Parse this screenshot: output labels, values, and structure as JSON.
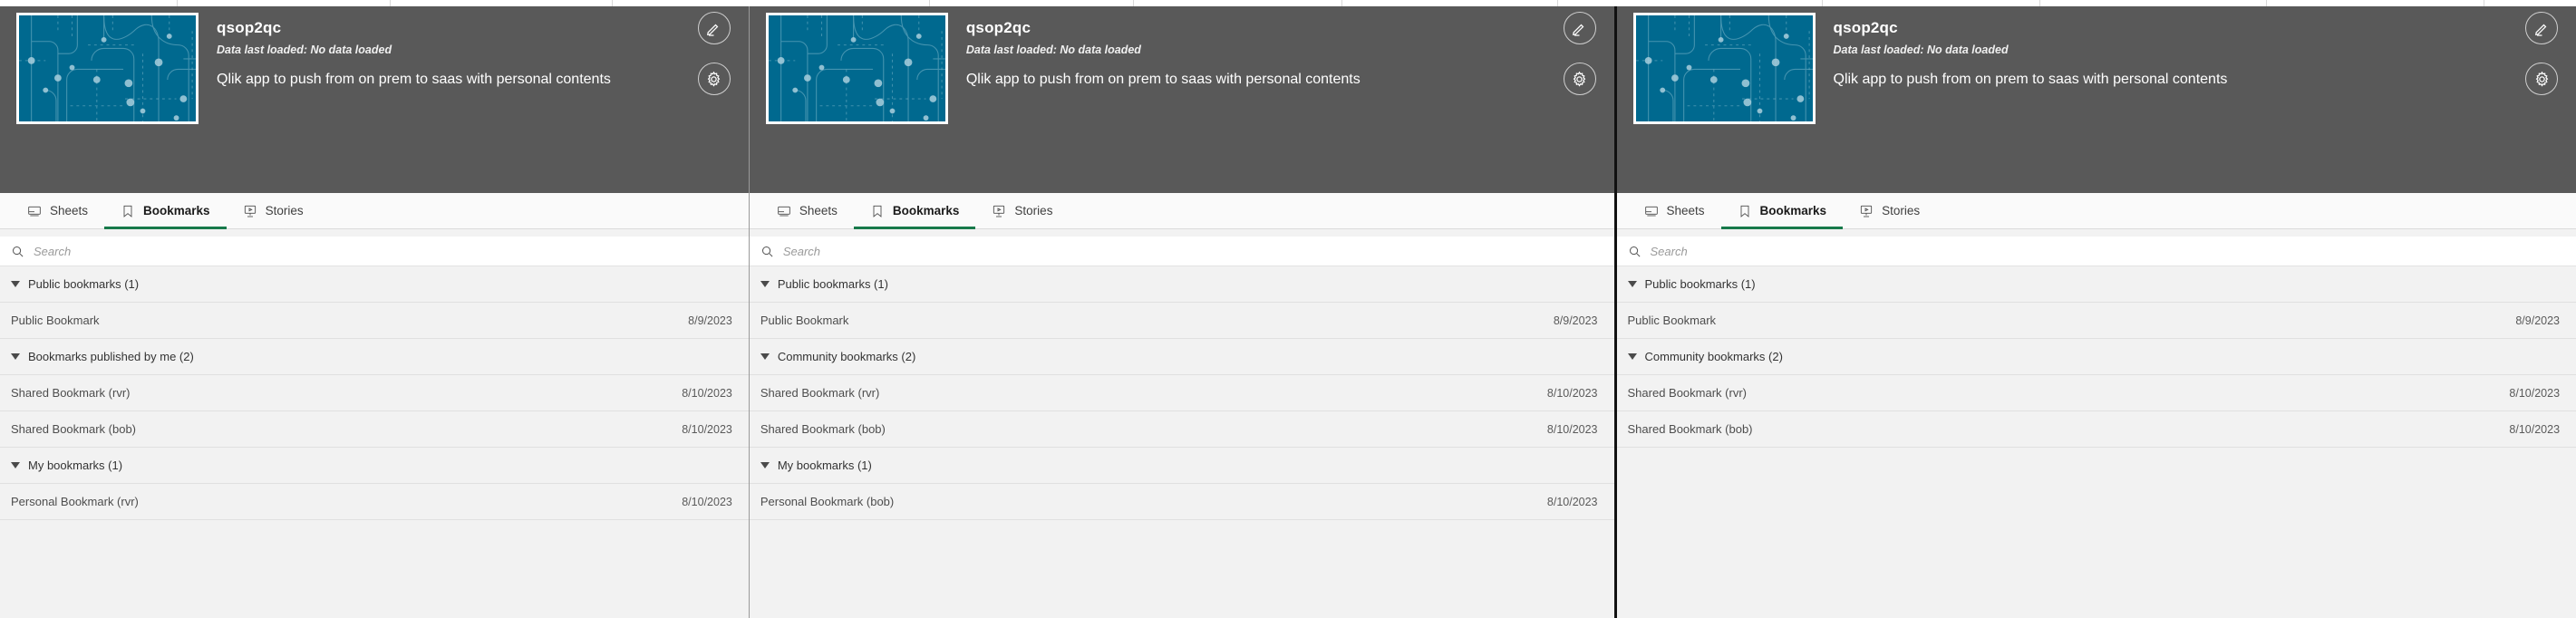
{
  "app": {
    "name": "qsop2qc",
    "data_loaded": "Data last loaded: No data loaded",
    "description": "Qlik app to push from on prem to saas with personal contents",
    "thumbnail_color": "#00698f",
    "edit_icon": "pencil-icon",
    "settings_icon": "gear-icon"
  },
  "tabs": [
    {
      "label": "Sheets",
      "icon": "sheets-icon",
      "active": false
    },
    {
      "label": "Bookmarks",
      "icon": "bookmark-icon",
      "active": true
    },
    {
      "label": "Stories",
      "icon": "story-icon",
      "active": false
    }
  ],
  "search": {
    "value": "",
    "placeholder": "Search",
    "icon": "search-icon"
  },
  "colors": {
    "accent": "#17794a",
    "header_bg": "#595959",
    "list_bg": "#f2f2f2",
    "tabbar_bg": "#fafafa",
    "thumb_bg": "#00698f"
  },
  "panels": [
    {
      "id": "panel-1",
      "groups": [
        {
          "label": "Public bookmarks",
          "count": "(1)",
          "items": [
            {
              "name": "Public Bookmark",
              "date": "8/9/2023"
            }
          ]
        },
        {
          "label": "Bookmarks published by me",
          "count": "(2)",
          "items": [
            {
              "name": "Shared Bookmark (rvr)",
              "date": "8/10/2023"
            },
            {
              "name": "Shared Bookmark (bob)",
              "date": "8/10/2023"
            }
          ]
        },
        {
          "label": "My bookmarks",
          "count": "(1)",
          "items": [
            {
              "name": "Personal Bookmark (rvr)",
              "date": "8/10/2023"
            }
          ]
        }
      ]
    },
    {
      "id": "panel-2",
      "groups": [
        {
          "label": "Public bookmarks",
          "count": "(1)",
          "items": [
            {
              "name": "Public Bookmark",
              "date": "8/9/2023"
            }
          ]
        },
        {
          "label": "Community bookmarks",
          "count": "(2)",
          "items": [
            {
              "name": "Shared Bookmark (rvr)",
              "date": "8/10/2023"
            },
            {
              "name": "Shared Bookmark (bob)",
              "date": "8/10/2023"
            }
          ]
        },
        {
          "label": "My bookmarks",
          "count": "(1)",
          "items": [
            {
              "name": "Personal Bookmark (bob)",
              "date": "8/10/2023"
            }
          ]
        }
      ]
    },
    {
      "id": "panel-3",
      "groups": [
        {
          "label": "Public bookmarks",
          "count": "(1)",
          "items": [
            {
              "name": "Public Bookmark",
              "date": "8/9/2023"
            }
          ]
        },
        {
          "label": "Community bookmarks",
          "count": "(2)",
          "items": [
            {
              "name": "Shared Bookmark (rvr)",
              "date": "8/10/2023"
            },
            {
              "name": "Shared Bookmark (bob)",
              "date": "8/10/2023"
            }
          ]
        }
      ]
    }
  ]
}
